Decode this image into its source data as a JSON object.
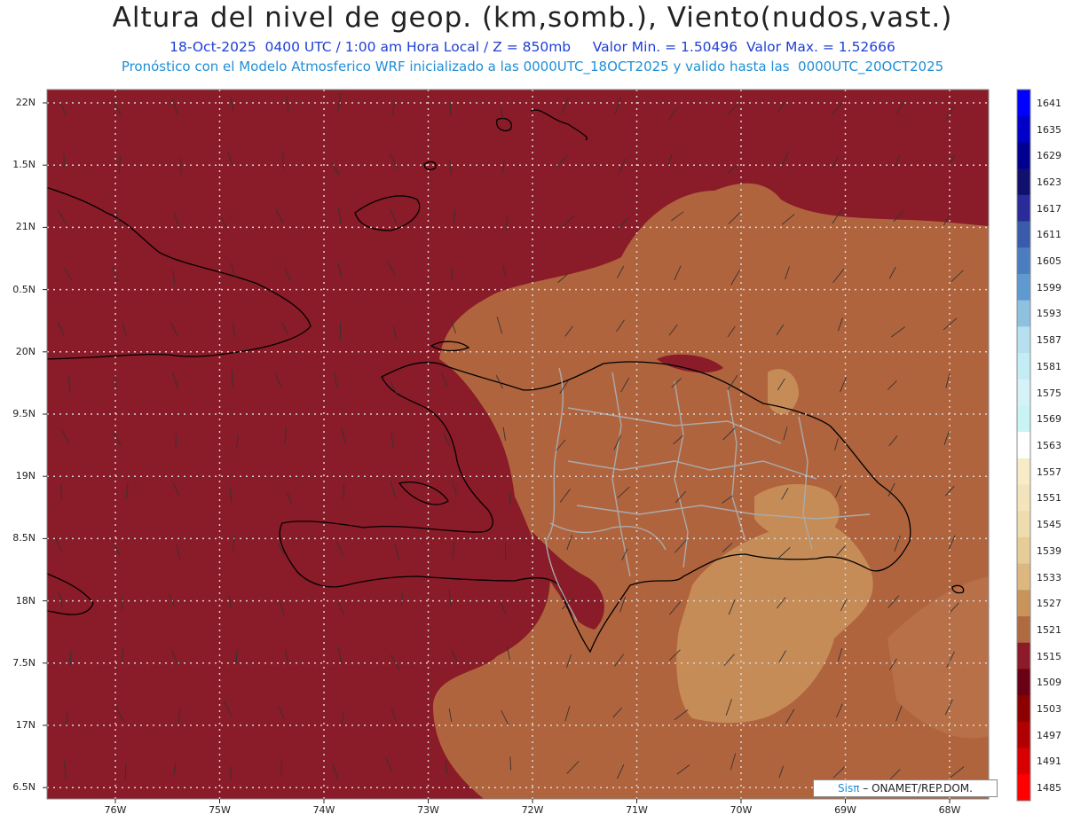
{
  "header": {
    "title": "Altura del nivel de geop. (km,somb.), Viento(nudos,vast.)",
    "subtitle": "18-Oct-2025  0400 UTC / 1:00 am Hora Local / Z = 850mb     Valor Min. = 1.50496  Valor Max. = 1.52666",
    "subtitle2": "Pronóstico con el Modelo Atmosferico WRF inicializado a las 0000UTC_18OCT2025 y valido hasta las  0000UTC_20OCT2025"
  },
  "axes": {
    "lat_labels": [
      "22N",
      "1.5N",
      "21N",
      "0.5N",
      "20N",
      "9.5N",
      "19N",
      "8.5N",
      "18N",
      "7.5N",
      "17N",
      "6.5N"
    ],
    "lon_labels": [
      "76W",
      "75W",
      "74W",
      "73W",
      "72W",
      "71W",
      "70W",
      "69W",
      "68W"
    ]
  },
  "colorbar": {
    "levels": [
      "1641",
      "1635",
      "1629",
      "1623",
      "1617",
      "1611",
      "1605",
      "1599",
      "1593",
      "1587",
      "1581",
      "1575",
      "1569",
      "1563",
      "1557",
      "1551",
      "1545",
      "1539",
      "1533",
      "1527",
      "1521",
      "1515",
      "1509",
      "1503",
      "1497",
      "1491",
      "1485"
    ],
    "colors": [
      "#0000ff",
      "#0000c8",
      "#000090",
      "#10106e",
      "#2a2a98",
      "#3a5aaa",
      "#4a7ec0",
      "#5e9ad0",
      "#8ec0e0",
      "#b6e0f0",
      "#c4ecf4",
      "#d4f2f8",
      "#c8f4f6",
      "#ffffff",
      "#f8ecc8",
      "#f4e4bc",
      "#eedcae",
      "#e6cc98",
      "#dcb880",
      "#c8945a",
      "#b06a40",
      "#8c1a28",
      "#6a0014",
      "#8c0000",
      "#b00000",
      "#d80000",
      "#ff0000"
    ]
  },
  "legend": {
    "brand": "Sisπ",
    "credit": "– ONAMET/REP.DOM."
  },
  "colors": {
    "sea": "#8a1b28",
    "land_low": "#b0643e",
    "land_mid": "#c68c58",
    "grid": "#d8d8d8"
  }
}
